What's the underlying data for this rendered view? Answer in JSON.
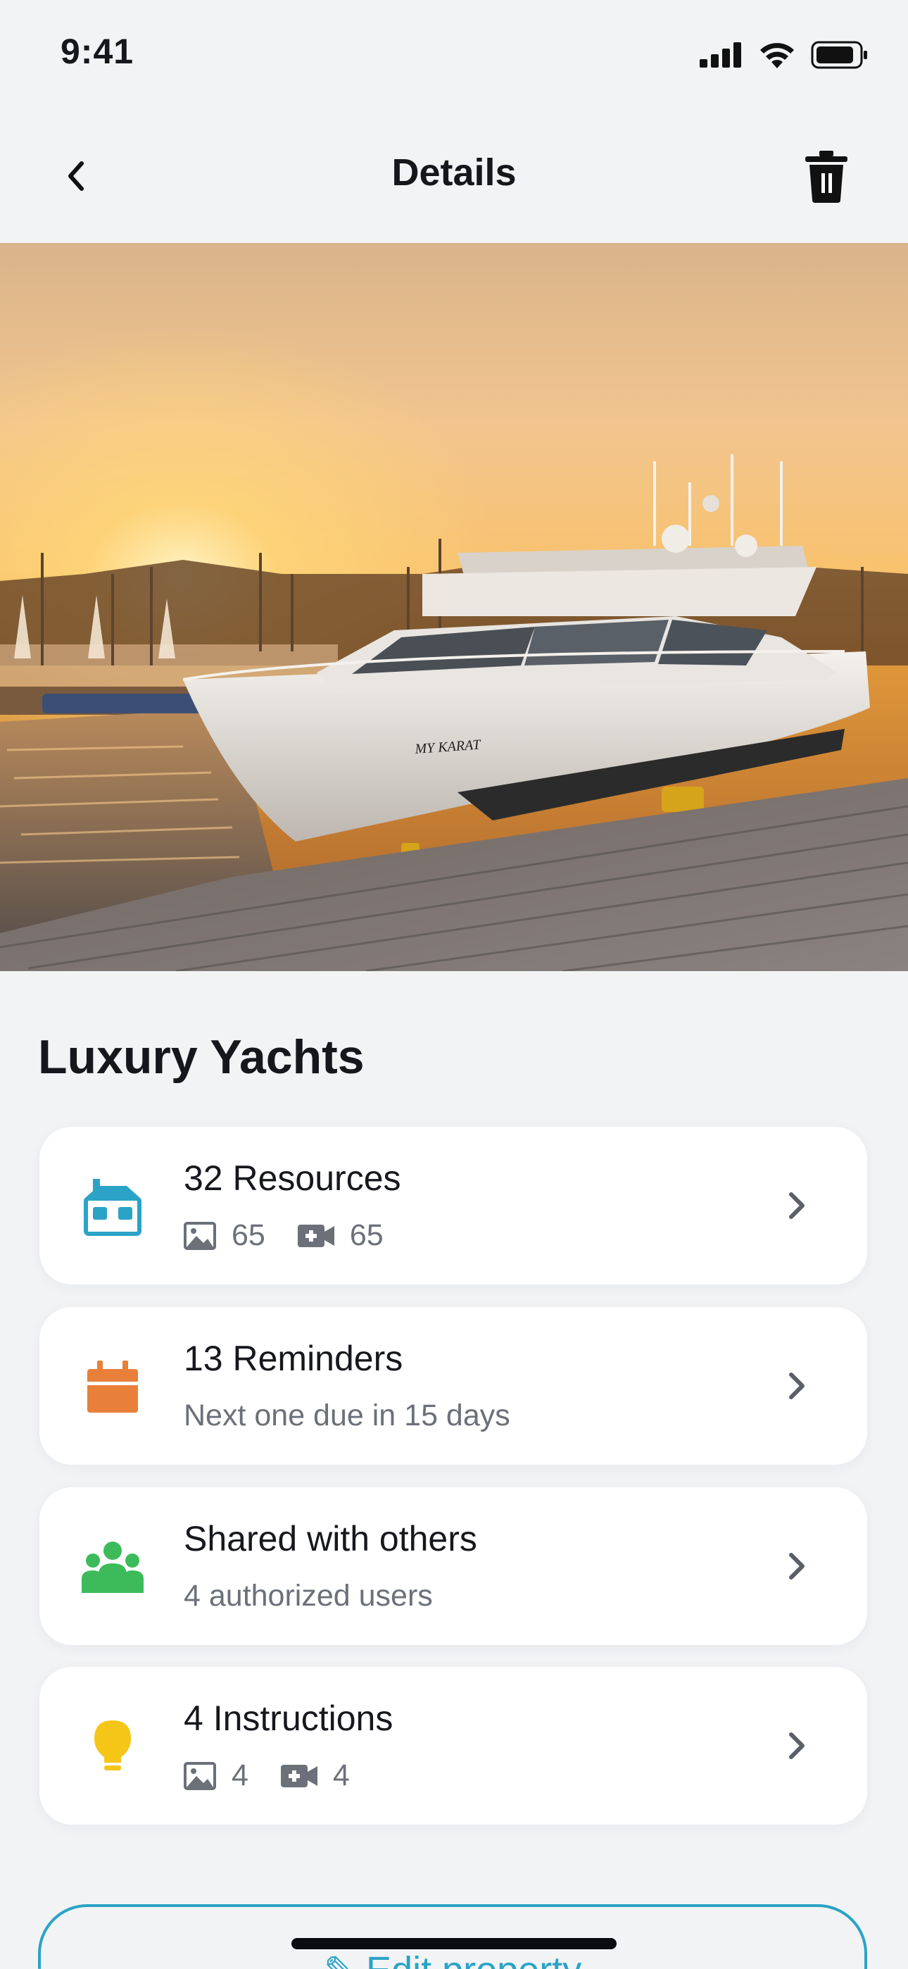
{
  "status_bar": {
    "time": "9:41"
  },
  "nav": {
    "title": "Details"
  },
  "property": {
    "title": "Luxury Yachts",
    "boat_name": "MY KARAT"
  },
  "cards": [
    {
      "title": "32 Resources",
      "images": "65",
      "videos": "65",
      "icon": "house-icon",
      "color": "#2aa3c6"
    },
    {
      "title": "13 Reminders",
      "subtitle": "Next one due in 15 days",
      "icon": "calendar-icon",
      "color": "#e8803a"
    },
    {
      "title": "Shared with others",
      "subtitle": "4 authorized users",
      "icon": "users-icon",
      "color": "#3dbb5a"
    },
    {
      "title": "4 Instructions",
      "images": "4",
      "videos": "4",
      "icon": "lightbulb-icon",
      "color": "#f5c518"
    }
  ],
  "actions": {
    "edit_label": "✎ Edit property"
  },
  "colors": {
    "accent": "#2aa3c6",
    "background": "#f2f3f5"
  }
}
